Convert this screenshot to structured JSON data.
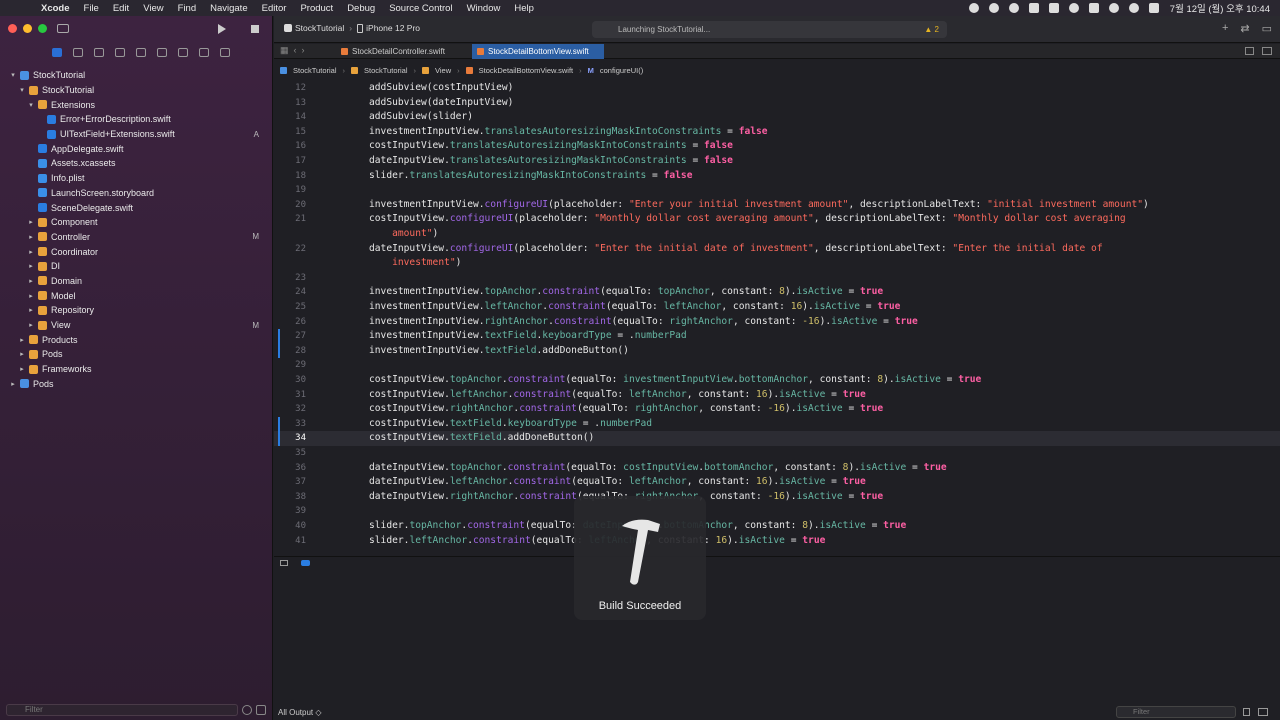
{
  "menubar": {
    "app": "Xcode",
    "items": [
      "File",
      "Edit",
      "View",
      "Find",
      "Navigate",
      "Editor",
      "Product",
      "Debug",
      "Source Control",
      "Window",
      "Help"
    ],
    "clock": "7월 12일 (월) 오후 10:44"
  },
  "toolbar": {
    "project": "StockTutorial",
    "device": "iPhone 12 Pro",
    "activity": "Launching StockTutorial...",
    "warning_count": "▲ 2"
  },
  "tabs": [
    {
      "label": "StockDetailController.swift"
    },
    {
      "label": "StockDetailBottomView.swift"
    }
  ],
  "jumpbar": [
    "StockTutorial",
    "StockTutorial",
    "View",
    "StockDetailBottomView.swift",
    "configureUI()"
  ],
  "navigator": {
    "items": [
      {
        "label": "StockTutorial",
        "indent": 0,
        "chevron": "▾",
        "kind": "proj",
        "badge": ""
      },
      {
        "label": "StockTutorial",
        "indent": 1,
        "chevron": "▾",
        "kind": "folder",
        "badge": ""
      },
      {
        "label": "Extensions",
        "indent": 2,
        "chevron": "▾",
        "kind": "folder",
        "badge": ""
      },
      {
        "label": "Error+ErrorDescription.swift",
        "indent": 3,
        "chevron": "",
        "kind": "swift",
        "badge": ""
      },
      {
        "label": "UITextField+Extensions.swift",
        "indent": 3,
        "chevron": "",
        "kind": "swift",
        "badge": "A"
      },
      {
        "label": "AppDelegate.swift",
        "indent": 2,
        "chevron": "",
        "kind": "swift",
        "badge": ""
      },
      {
        "label": "Assets.xcassets",
        "indent": 2,
        "chevron": "",
        "kind": "blue",
        "badge": ""
      },
      {
        "label": "Info.plist",
        "indent": 2,
        "chevron": "",
        "kind": "blue",
        "badge": ""
      },
      {
        "label": "LaunchScreen.storyboard",
        "indent": 2,
        "chevron": "",
        "kind": "blue",
        "badge": ""
      },
      {
        "label": "SceneDelegate.swift",
        "indent": 2,
        "chevron": "",
        "kind": "swift",
        "badge": ""
      },
      {
        "label": "Component",
        "indent": 2,
        "chevron": "▸",
        "kind": "folder",
        "badge": ""
      },
      {
        "label": "Controller",
        "indent": 2,
        "chevron": "▸",
        "kind": "folder",
        "badge": "M"
      },
      {
        "label": "Coordinator",
        "indent": 2,
        "chevron": "▸",
        "kind": "folder",
        "badge": ""
      },
      {
        "label": "DI",
        "indent": 2,
        "chevron": "▸",
        "kind": "folder",
        "badge": ""
      },
      {
        "label": "Domain",
        "indent": 2,
        "chevron": "▸",
        "kind": "folder",
        "badge": ""
      },
      {
        "label": "Model",
        "indent": 2,
        "chevron": "▸",
        "kind": "folder",
        "badge": ""
      },
      {
        "label": "Repository",
        "indent": 2,
        "chevron": "▸",
        "kind": "folder",
        "badge": ""
      },
      {
        "label": "View",
        "indent": 2,
        "chevron": "▸",
        "kind": "folder",
        "badge": "M"
      },
      {
        "label": "Products",
        "indent": 1,
        "chevron": "▸",
        "kind": "folder",
        "badge": ""
      },
      {
        "label": "Pods",
        "indent": 1,
        "chevron": "▸",
        "kind": "folder",
        "badge": ""
      },
      {
        "label": "Frameworks",
        "indent": 1,
        "chevron": "▸",
        "kind": "folder",
        "badge": ""
      },
      {
        "label": "Pods",
        "indent": 0,
        "chevron": "▸",
        "kind": "proj",
        "badge": ""
      }
    ],
    "filter_placeholder": "Filter"
  },
  "code": [
    {
      "ln": "12",
      "html": "addSubview(costInputView)"
    },
    {
      "ln": "13",
      "html": "addSubview(dateInputView)"
    },
    {
      "ln": "14",
      "html": "addSubview(slider)"
    },
    {
      "ln": "15",
      "html": "investmentInputView.<span class='p'>translatesAutoresizingMaskIntoConstraints</span> = <span class='k'>false</span>"
    },
    {
      "ln": "16",
      "html": "costInputView.<span class='p'>translatesAutoresizingMaskIntoConstraints</span> = <span class='k'>false</span>"
    },
    {
      "ln": "17",
      "html": "dateInputView.<span class='p'>translatesAutoresizingMaskIntoConstraints</span> = <span class='k'>false</span>"
    },
    {
      "ln": "18",
      "html": "slider.<span class='p'>translatesAutoresizingMaskIntoConstraints</span> = <span class='k'>false</span>"
    },
    {
      "ln": "19",
      "html": ""
    },
    {
      "ln": "20",
      "html": "investmentInputView.<span class='m'>configureUI</span>(placeholder: <span class='s'>\"Enter your initial investment amount\"</span>, descriptionLabelText: <span class='s'>\"initial investment amount\"</span>)"
    },
    {
      "ln": "21",
      "html": "costInputView.<span class='m'>configureUI</span>(placeholder: <span class='s'>\"Monthly dollar cost averaging amount\"</span>, descriptionLabelText: <span class='s'>\"Monthly dollar cost averaging</span>"
    },
    {
      "ln": "",
      "html": "    <span class='s'>amount\"</span>)"
    },
    {
      "ln": "22",
      "html": "dateInputView.<span class='m'>configureUI</span>(placeholder: <span class='s'>\"Enter the initial date of investment\"</span>, descriptionLabelText: <span class='s'>\"Enter the initial date of</span>"
    },
    {
      "ln": "",
      "html": "    <span class='s'>investment\"</span>)"
    },
    {
      "ln": "23",
      "html": ""
    },
    {
      "ln": "24",
      "html": "investmentInputView.<span class='p'>topAnchor</span>.<span class='m'>constraint</span>(equalTo: <span class='p'>topAnchor</span>, constant: <span class='n'>8</span>).<span class='p'>isActive</span> = <span class='k'>true</span>"
    },
    {
      "ln": "25",
      "html": "investmentInputView.<span class='p'>leftAnchor</span>.<span class='m'>constraint</span>(equalTo: <span class='p'>leftAnchor</span>, constant: <span class='n'>16</span>).<span class='p'>isActive</span> = <span class='k'>true</span>"
    },
    {
      "ln": "26",
      "html": "investmentInputView.<span class='p'>rightAnchor</span>.<span class='m'>constraint</span>(equalTo: <span class='p'>rightAnchor</span>, constant: <span class='n'>-16</span>).<span class='p'>isActive</span> = <span class='k'>true</span>"
    },
    {
      "ln": "27",
      "html": "investmentInputView.<span class='p'>textField</span>.<span class='p'>keyboardType</span> = .<span class='p'>numberPad</span>"
    },
    {
      "ln": "28",
      "html": "investmentInputView.<span class='p'>textField</span>.addDoneButton()"
    },
    {
      "ln": "29",
      "html": ""
    },
    {
      "ln": "30",
      "html": "costInputView.<span class='p'>topAnchor</span>.<span class='m'>constraint</span>(equalTo: <span class='p'>investmentInputView</span>.<span class='p'>bottomAnchor</span>, constant: <span class='n'>8</span>).<span class='p'>isActive</span> = <span class='k'>true</span>"
    },
    {
      "ln": "31",
      "html": "costInputView.<span class='p'>leftAnchor</span>.<span class='m'>constraint</span>(equalTo: <span class='p'>leftAnchor</span>, constant: <span class='n'>16</span>).<span class='p'>isActive</span> = <span class='k'>true</span>"
    },
    {
      "ln": "32",
      "html": "costInputView.<span class='p'>rightAnchor</span>.<span class='m'>constraint</span>(equalTo: <span class='p'>rightAnchor</span>, constant: <span class='n'>-16</span>).<span class='p'>isActive</span> = <span class='k'>true</span>"
    },
    {
      "ln": "33",
      "html": "costInputView.<span class='p'>textField</span>.<span class='p'>keyboardType</span> = .<span class='p'>numberPad</span>"
    },
    {
      "ln": "34",
      "html": "costInputView.<span class='p'>textField</span>.addDoneButton()"
    },
    {
      "ln": "35",
      "html": ""
    },
    {
      "ln": "36",
      "html": "dateInputView.<span class='p'>topAnchor</span>.<span class='m'>constraint</span>(equalTo: <span class='p'>costInputView</span>.<span class='p'>bottomAnchor</span>, constant: <span class='n'>8</span>).<span class='p'>isActive</span> = <span class='k'>true</span>"
    },
    {
      "ln": "37",
      "html": "dateInputView.<span class='p'>leftAnchor</span>.<span class='m'>constraint</span>(equalTo: <span class='p'>leftAnchor</span>, constant: <span class='n'>16</span>).<span class='p'>isActive</span> = <span class='k'>true</span>"
    },
    {
      "ln": "38",
      "html": "dateInputView.<span class='p'>rightAnchor</span>.<span class='m'>constraint</span>(equalTo: <span class='p'>rightAnchor</span>, constant: <span class='n'>-16</span>).<span class='p'>isActive</span> = <span class='k'>true</span>"
    },
    {
      "ln": "39",
      "html": ""
    },
    {
      "ln": "40",
      "html": "slider.<span class='p'>topAnchor</span>.<span class='m'>constraint</span>(equalTo: <span class='p'>dateInputView</span>.<span class='p'>bottomAnchor</span>, constant: <span class='n'>8</span>).<span class='p'>isActive</span> = <span class='k'>true</span>"
    },
    {
      "ln": "41",
      "html": "slider.<span class='p'>leftAnchor</span>.<span class='m'>constraint</span>(equalTo: <span class='p'>leftAnchor</span>, constant: <span class='n'>16</span>).<span class='p'>isActive</span> = <span class='k'>true</span>"
    }
  ],
  "current_line": "34",
  "modified_lines": [
    "27",
    "28",
    "33",
    "34"
  ],
  "hud": {
    "label": "Build Succeeded"
  },
  "console": {
    "output_selector": "All Output ◇",
    "filter_placeholder": "Filter"
  }
}
